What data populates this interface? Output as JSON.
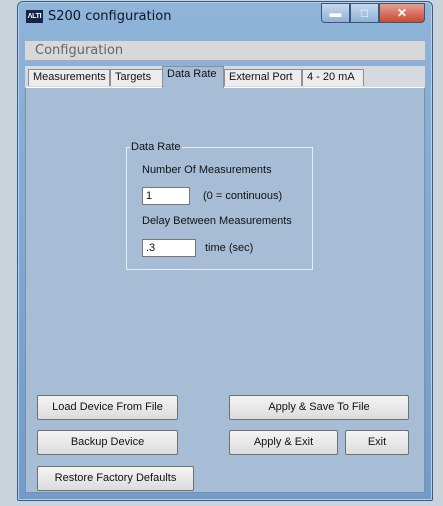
{
  "window": {
    "app_icon_text": "ΛLTI",
    "title": "S200 configuration",
    "minimize_glyph": "▬",
    "maximize_glyph": "□",
    "close_glyph": "✕"
  },
  "menu": {
    "configuration": "Configuration"
  },
  "tabs": [
    "Measurements",
    "Targets",
    "Data Rate",
    "External Port",
    "4 - 20 mA"
  ],
  "active_tab": "Data Rate",
  "data_rate": {
    "group_title": "Data Rate",
    "num_measurements_label": "Number Of Measurements",
    "num_measurements_value": "1",
    "num_measurements_hint": "(0 = continuous)",
    "delay_label": "Delay Between Measurements",
    "delay_value": ".3",
    "delay_hint": "time (sec)"
  },
  "buttons": {
    "load_device": "Load Device From File",
    "apply_save": "Apply & Save To File",
    "backup_device": "Backup Device",
    "apply_exit": "Apply & Exit",
    "exit": "Exit",
    "restore_defaults": "Restore Factory Defaults"
  }
}
